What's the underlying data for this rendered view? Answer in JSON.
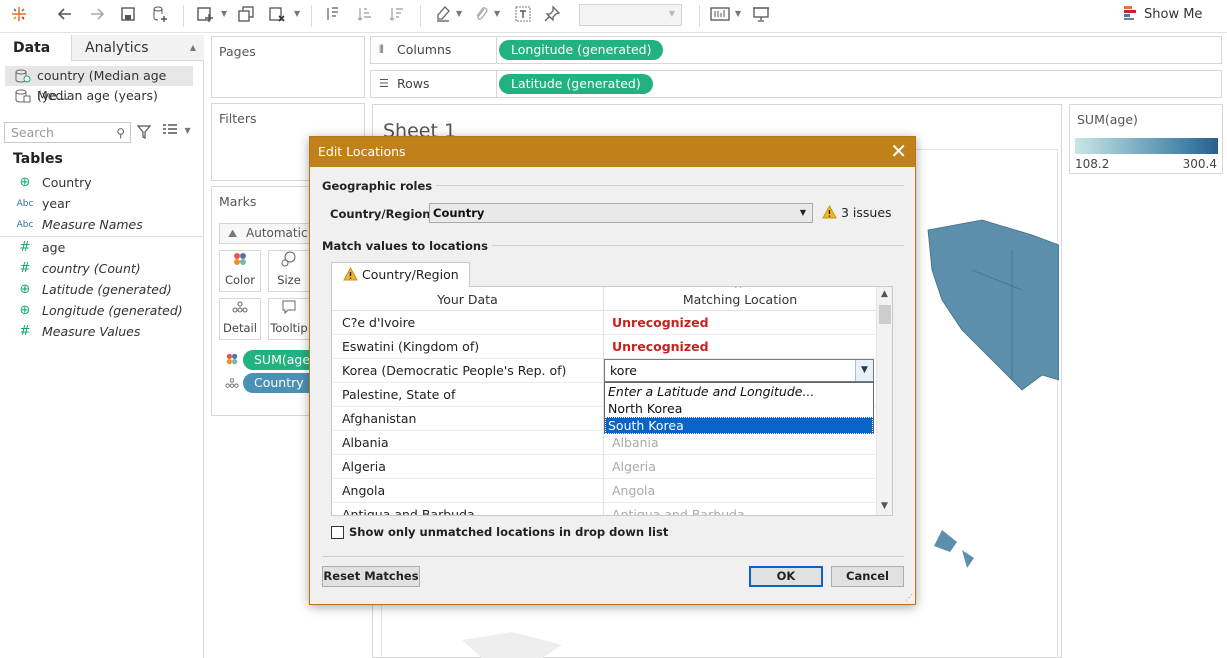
{
  "toolbar": {
    "icons": [
      "tableau-logo-icon",
      "undo-icon",
      "redo-icon",
      "save-icon",
      "new-datasource-icon",
      "new-worksheet-icon",
      "duplicate-icon",
      "clear-icon",
      "swap-icon",
      "sort-ascending-icon",
      "sort-descending-icon",
      "highlight-icon",
      "group-icon",
      "label-icon",
      "pin-icon",
      "fit-icon",
      "presentation-icon"
    ],
    "show_me": "Show Me"
  },
  "left_pane": {
    "tab_data": "Data",
    "tab_analytics": "Analytics",
    "datasources": [
      {
        "label": "country (Median age (ye..."
      },
      {
        "label": "Median age (years)"
      }
    ],
    "search_placeholder": "Search",
    "tables_heading": "Tables",
    "fields": [
      {
        "label": "Country",
        "type": "globe",
        "italic": false
      },
      {
        "label": "year",
        "type": "Abc",
        "italic": false
      },
      {
        "label": "Measure Names",
        "type": "Abc",
        "italic": true
      },
      {
        "label": "age",
        "type": "#",
        "italic": false
      },
      {
        "label": "country (Count)",
        "type": "#",
        "italic": true
      },
      {
        "label": "Latitude (generated)",
        "type": "globe",
        "italic": true
      },
      {
        "label": "Longitude (generated)",
        "type": "globe",
        "italic": true
      },
      {
        "label": "Measure Values",
        "type": "#",
        "italic": true
      }
    ]
  },
  "shelves": {
    "pages": "Pages",
    "filters": "Filters",
    "marks": "Marks",
    "marks_type": "Automatic",
    "mark_buttons": [
      {
        "label": "Color",
        "icon": "color-icon"
      },
      {
        "label": "Size",
        "icon": "size-icon"
      },
      {
        "label": "Detail",
        "icon": "detail-icon"
      },
      {
        "label": "Tooltip",
        "icon": "tooltip-icon"
      }
    ],
    "mark_pills": [
      "SUM(age)",
      "Country"
    ],
    "columns_label": "Columns",
    "columns_pill": "Longitude (generated)",
    "rows_label": "Rows",
    "rows_pill": "Latitude (generated)"
  },
  "view": {
    "sheet_title": "Sheet 1"
  },
  "legend": {
    "title": "SUM(age)",
    "min": "108.2",
    "max": "300.4",
    "color_low": "#c9e6e6",
    "color_high": "#2b5e8c"
  },
  "dialog": {
    "title": "Edit Locations",
    "geo_roles_label": "Geographic roles",
    "country_region_label": "Country/Region:",
    "country_region_value": "Country",
    "issues": "3 issues",
    "match_label": "Match values to locations",
    "tab_label": "Country/Region",
    "col_your_data": "Your Data",
    "col_matching": "Matching Location",
    "rows": [
      {
        "your": "C?e d'Ivoire",
        "match": "Unrecognized",
        "status": "unrecognized"
      },
      {
        "your": "Eswatini (Kingdom of)",
        "match": "Unrecognized",
        "status": "unrecognized"
      },
      {
        "your": "Korea (Democratic People's Rep. of)",
        "match": "",
        "status": "editing"
      },
      {
        "your": "Palestine, State of",
        "match": "",
        "status": "matched"
      },
      {
        "your": "Afghanistan",
        "match": "",
        "status": "matched"
      },
      {
        "your": "Albania",
        "match": "Albania",
        "status": "matched"
      },
      {
        "your": "Algeria",
        "match": "Algeria",
        "status": "matched"
      },
      {
        "your": "Angola",
        "match": "Angola",
        "status": "matched"
      },
      {
        "your": "Antigua and Barbuda",
        "match": "Antigua and Barbuda",
        "status": "matched"
      }
    ],
    "combo_value": "kore",
    "combo_options": [
      {
        "label": "Enter a Latitude and Longitude...",
        "italic": true,
        "selected": false
      },
      {
        "label": "North Korea",
        "italic": false,
        "selected": false
      },
      {
        "label": "South Korea",
        "italic": false,
        "selected": true
      }
    ],
    "checkbox_label": "Show only unmatched locations in drop down list",
    "reset_label": "Reset Matches",
    "ok_label": "OK",
    "cancel_label": "Cancel"
  }
}
